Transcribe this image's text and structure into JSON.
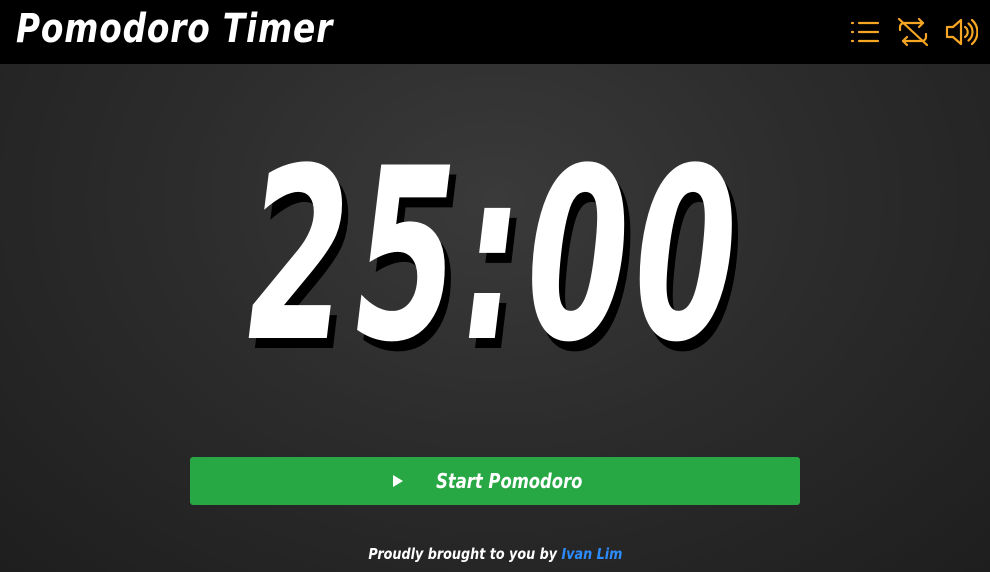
{
  "header": {
    "title": "Pomodoro Timer",
    "icons": [
      "list-icon",
      "repeat-off-icon",
      "volume-icon"
    ]
  },
  "timer": {
    "display": "25:00"
  },
  "actions": {
    "start_label": "Start Pomodoro",
    "start_icon": "play-icon"
  },
  "footer": {
    "prefix": "Proudly brought to you by",
    "author": "Ivan Lim"
  },
  "colors": {
    "header_bg": "#000000",
    "accent_icons": "#f5a623",
    "start_button": "#28a745",
    "link": "#2d8cff",
    "text": "#ffffff"
  }
}
